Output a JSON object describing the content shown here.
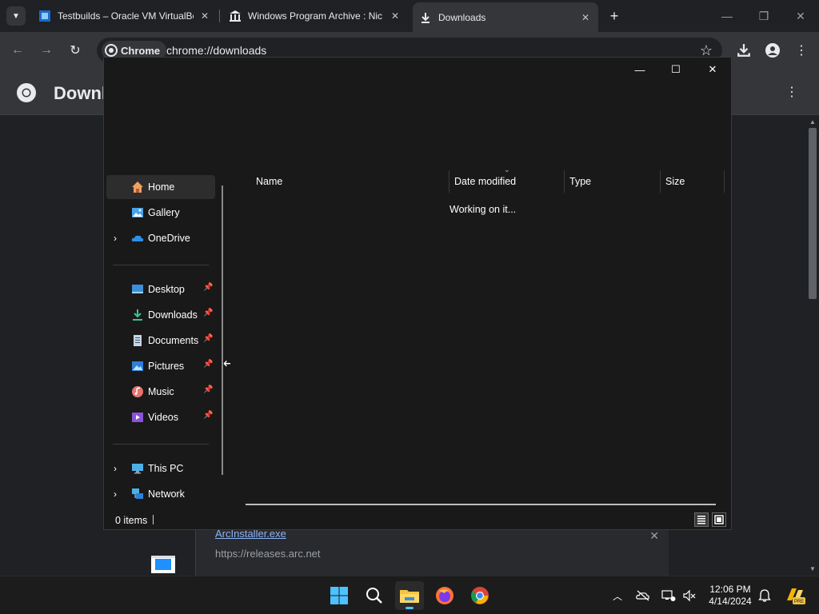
{
  "browser": {
    "tabs": [
      {
        "title": "Testbuilds – Oracle VM VirtualBox",
        "favicon": "virtualbox-icon",
        "active": false
      },
      {
        "title": "Windows Program Archive : Nic",
        "favicon": "archive-icon",
        "active": false
      },
      {
        "title": "Downloads",
        "favicon": "download-icon",
        "active": true
      }
    ],
    "chip_label": "Chrome",
    "url": "chrome://downloads"
  },
  "downloads_page": {
    "title": "Downloads",
    "item": {
      "filename": "ArcInstaller.exe",
      "source_url": "https://releases.arc.net"
    }
  },
  "explorer": {
    "nav": {
      "items": [
        {
          "label": "Home",
          "icon": "home-icon",
          "expandable": false,
          "pinned": false,
          "selected": true
        },
        {
          "label": "Gallery",
          "icon": "gallery-icon",
          "expandable": false,
          "pinned": false,
          "selected": false
        },
        {
          "label": "OneDrive",
          "icon": "onedrive-icon",
          "expandable": true,
          "pinned": false,
          "selected": false
        },
        {
          "label": "Desktop",
          "icon": "desktop-icon",
          "expandable": false,
          "pinned": true,
          "selected": false
        },
        {
          "label": "Downloads",
          "icon": "downloads-icon",
          "expandable": false,
          "pinned": true,
          "selected": false
        },
        {
          "label": "Documents",
          "icon": "documents-icon",
          "expandable": false,
          "pinned": true,
          "selected": false
        },
        {
          "label": "Pictures",
          "icon": "pictures-icon",
          "expandable": false,
          "pinned": true,
          "selected": false
        },
        {
          "label": "Music",
          "icon": "music-icon",
          "expandable": false,
          "pinned": true,
          "selected": false
        },
        {
          "label": "Videos",
          "icon": "videos-icon",
          "expandable": false,
          "pinned": true,
          "selected": false
        },
        {
          "label": "This PC",
          "icon": "this-pc-icon",
          "expandable": true,
          "pinned": false,
          "selected": false
        },
        {
          "label": "Network",
          "icon": "network-icon",
          "expandable": true,
          "pinned": false,
          "selected": false
        }
      ]
    },
    "columns": [
      "Name",
      "Date modified",
      "Type",
      "Size"
    ],
    "status_message": "Working on it...",
    "item_count": "0 items"
  },
  "taskbar": {
    "apps": [
      "start-icon",
      "search-icon",
      "file-explorer-icon",
      "firefox-icon",
      "chrome-icon"
    ],
    "time": "12:06 PM",
    "date": "4/14/2024",
    "copilot_badge": "PRE"
  },
  "colors": {
    "chrome_dark": "#202124",
    "chrome_toolbar": "#35363a",
    "explorer_bg": "#191919",
    "link": "#8ab4f8",
    "accent": "#4cc2ff"
  }
}
